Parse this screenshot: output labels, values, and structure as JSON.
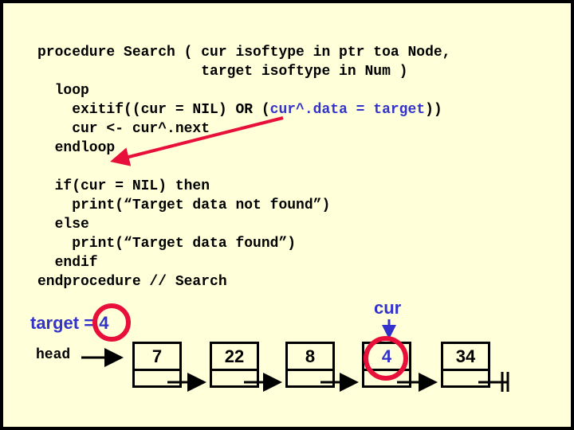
{
  "code": {
    "line1": "procedure Search ( cur isoftype in ptr toa Node,",
    "line2": "                   target isoftype in Num )",
    "line3": "  loop",
    "line4a": "    exitif((cur = NIL) OR (",
    "line4b": "cur^.data = target",
    "line4c": "))",
    "line5": "    cur <- cur^.next",
    "line6": "  endloop",
    "line7": "",
    "line8": "  if(cur = NIL) then",
    "line9": "    print(“Target data not found”)",
    "line10": "  else",
    "line11": "    print(“Target data found”)",
    "line12": "  endif",
    "line13": "endprocedure // Search"
  },
  "diagram": {
    "target_label": "target = 4",
    "cur_label": "cur",
    "head_label": "head",
    "nodes": [
      "7",
      "22",
      "8",
      "4",
      "34"
    ],
    "highlight_color": "#e8103a",
    "accent_color": "#3333cc"
  }
}
